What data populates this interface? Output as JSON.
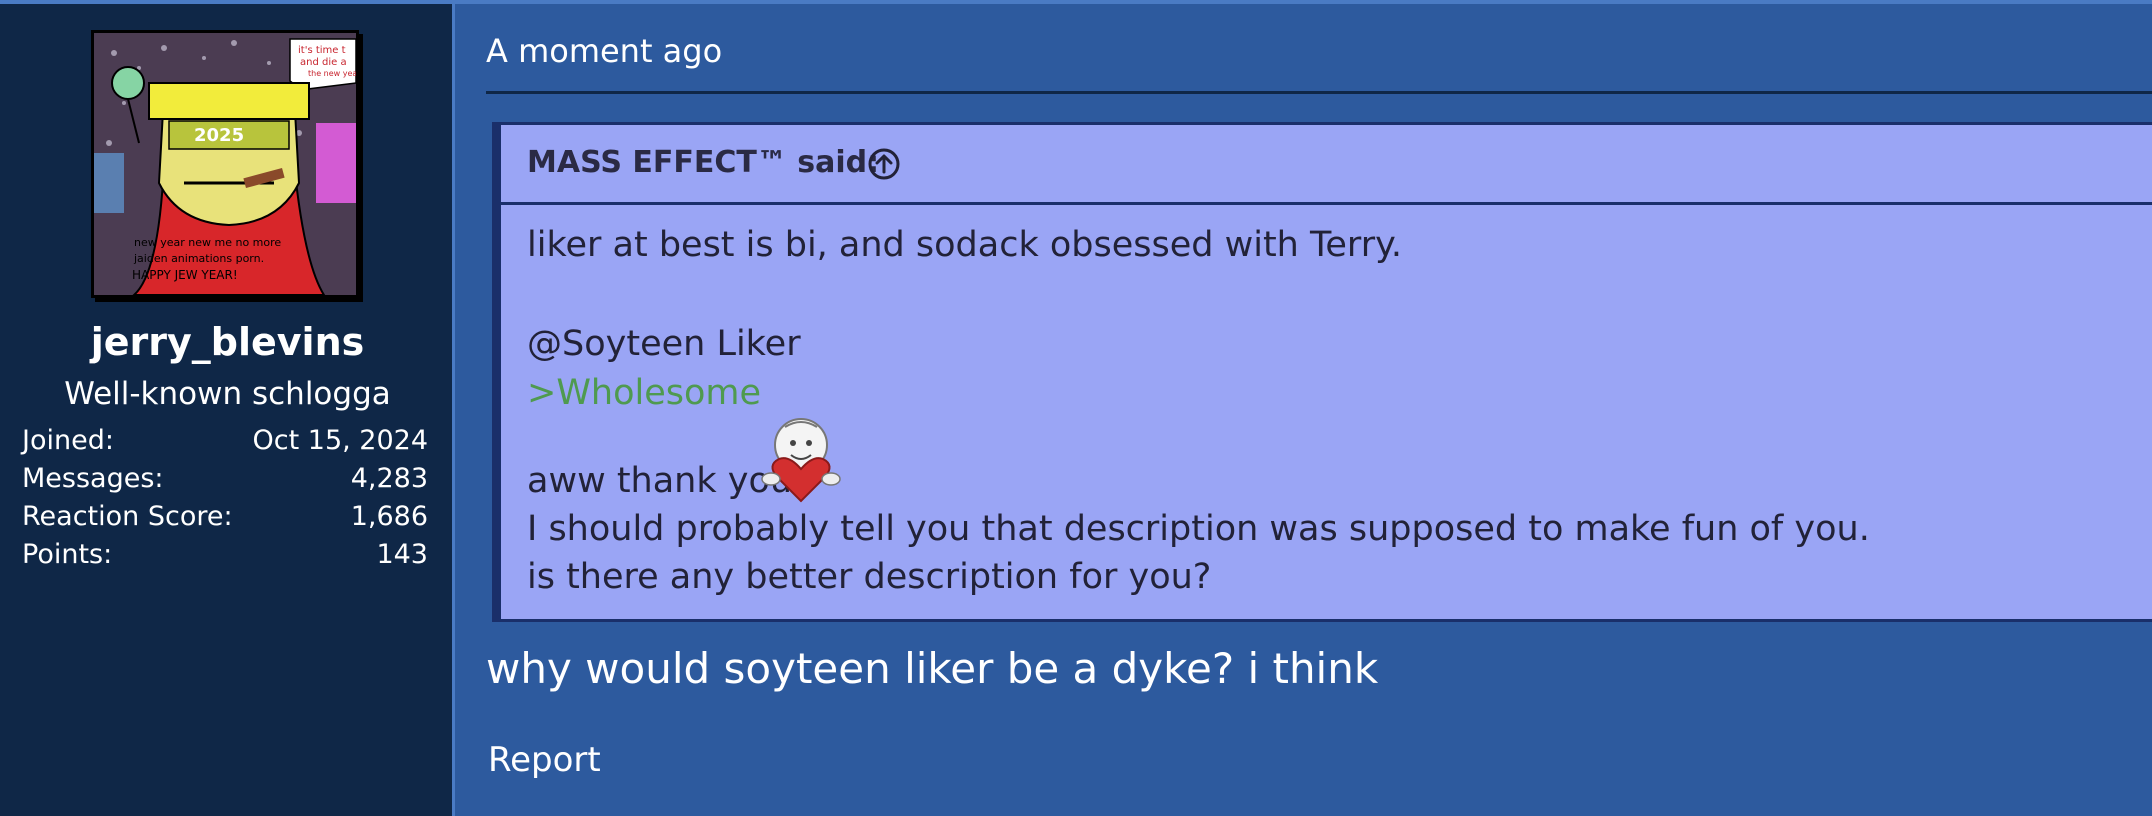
{
  "user": {
    "username": "jerry_blevins",
    "title": "Well-known schlogga",
    "avatar_text": {
      "bubble": "it's time to ... and die ... the new yea...",
      "year": "2025",
      "caption_line1": "new year new me no more",
      "caption_line2": "jaiden animations porn.",
      "caption_line3": "HAPPY JEW YEAR!"
    },
    "stats": [
      {
        "label": "Joined:",
        "value": "Oct 15, 2024"
      },
      {
        "label": "Messages:",
        "value": "4,283"
      },
      {
        "label": "Reaction Score:",
        "value": "1,686"
      },
      {
        "label": "Points:",
        "value": "143"
      }
    ]
  },
  "post": {
    "timestamp": "A moment ago",
    "quote": {
      "author": "MASS EFFECT™ said:",
      "line1": "liker at best is bi, and sodack obsessed with Terry.",
      "line2": "@Soyteen Liker",
      "line3": ">Wholesome",
      "line4": "aww thank you",
      "line5": "I should probably tell you that description was supposed to make fun of you.",
      "line6": "is there any better description for you?"
    },
    "body": "why would soyteen liker be a dyke? i think",
    "report_label": "Report"
  },
  "colors": {
    "page_bg": "#2d5a9e",
    "sidebar_bg": "#0f2747",
    "quote_bg": "#9aa5f5",
    "greentext": "#4f9a4f"
  },
  "icons": {
    "quote_jump": "arrow-up-circle-icon",
    "emoji": "heart-hug-emoji-icon"
  }
}
